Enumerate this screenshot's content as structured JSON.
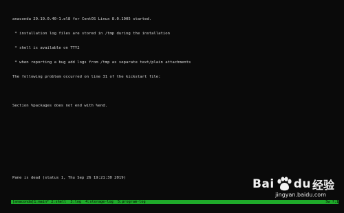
{
  "console": {
    "lines": [
      "anaconda 29.19.0.40-1.el8 for CentOS Linux 8.0.1905 started.",
      " * installation log files are stored in /tmp during the installation",
      " * shell is available on TTY2",
      " * when reporting a bug add logs from /tmp as separate text/plain attachments",
      "The following problem occurred on line 31 of the kickstart file:",
      "",
      "Section %packages does not end with %end."
    ],
    "pane_status": "Pane is dead (status 1, Thu Sep 26 19:21:30 2019)"
  },
  "tmux_status": {
    "windows": "[anaconda]1:main* 2:shell  3:log  4:storage-log  5:program-log",
    "right": "Sw ?:1"
  },
  "watermark": {
    "brand_left": "Bai",
    "brand_right": "du",
    "brand_suffix": "经验",
    "url": "jingyan.baidu.com"
  },
  "colors": {
    "background": "#0a0a0a",
    "text": "#d8d8d8",
    "status_bar": "#1faa2a"
  }
}
